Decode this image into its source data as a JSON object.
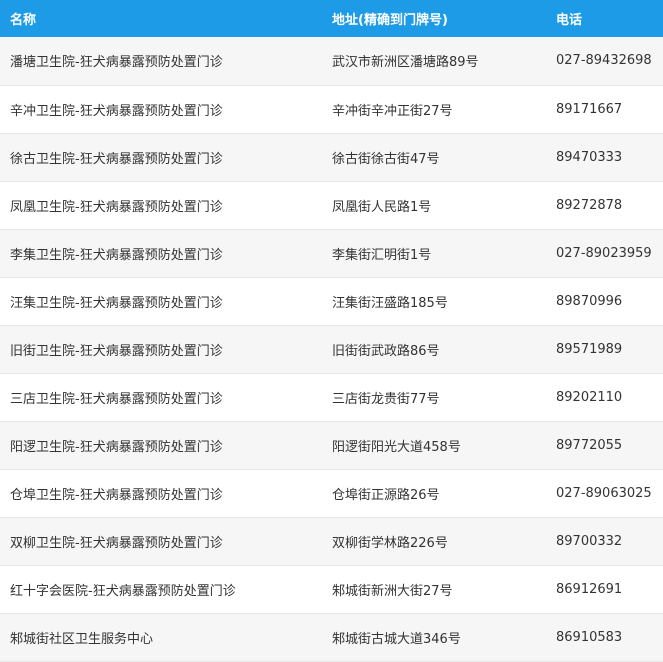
{
  "table": {
    "headers": {
      "name": "名称",
      "address": "地址(精确到门牌号)",
      "phone": "电话"
    },
    "rows": [
      {
        "name": "潘塘卫生院-狂犬病暴露预防处置门诊",
        "address": "武汉市新洲区潘塘路89号",
        "phone": "027-89432698"
      },
      {
        "name": "辛冲卫生院-狂犬病暴露预防处置门诊",
        "address": "辛冲街辛冲正街27号",
        "phone": "89171667"
      },
      {
        "name": "徐古卫生院-狂犬病暴露预防处置门诊",
        "address": "徐古街徐古街47号",
        "phone": "89470333"
      },
      {
        "name": "凤凰卫生院-狂犬病暴露预防处置门诊",
        "address": "凤凰街人民路1号",
        "phone": "89272878"
      },
      {
        "name": "李集卫生院-狂犬病暴露预防处置门诊",
        "address": "李集街汇明街1号",
        "phone": "027-89023959"
      },
      {
        "name": "汪集卫生院-狂犬病暴露预防处置门诊",
        "address": "汪集街汪盛路185号",
        "phone": "89870996"
      },
      {
        "name": "旧街卫生院-狂犬病暴露预防处置门诊",
        "address": "旧街街武政路86号",
        "phone": "89571989"
      },
      {
        "name": "三店卫生院-狂犬病暴露预防处置门诊",
        "address": "三店街龙贵街77号",
        "phone": "89202110"
      },
      {
        "name": "阳逻卫生院-狂犬病暴露预防处置门诊",
        "address": "阳逻街阳光大道458号",
        "phone": "89772055"
      },
      {
        "name": "仓埠卫生院-狂犬病暴露预防处置门诊",
        "address": "仓埠街正源路26号",
        "phone": "027-89063025"
      },
      {
        "name": "双柳卫生院-狂犬病暴露预防处置门诊",
        "address": "双柳街学林路226号",
        "phone": "89700332"
      },
      {
        "name": "红十字会医院-狂犬病暴露预防处置门诊",
        "address": "邾城街新洲大街27号",
        "phone": "86912691"
      },
      {
        "name": "邾城街社区卫生服务中心",
        "address": "邾城街古城大道346号",
        "phone": "86910583"
      }
    ]
  },
  "colors": {
    "header_bg": "#1d9be6",
    "header_text": "#ffffff",
    "row_alt_bg": "#f6f6f6",
    "body_text": "#333333"
  }
}
